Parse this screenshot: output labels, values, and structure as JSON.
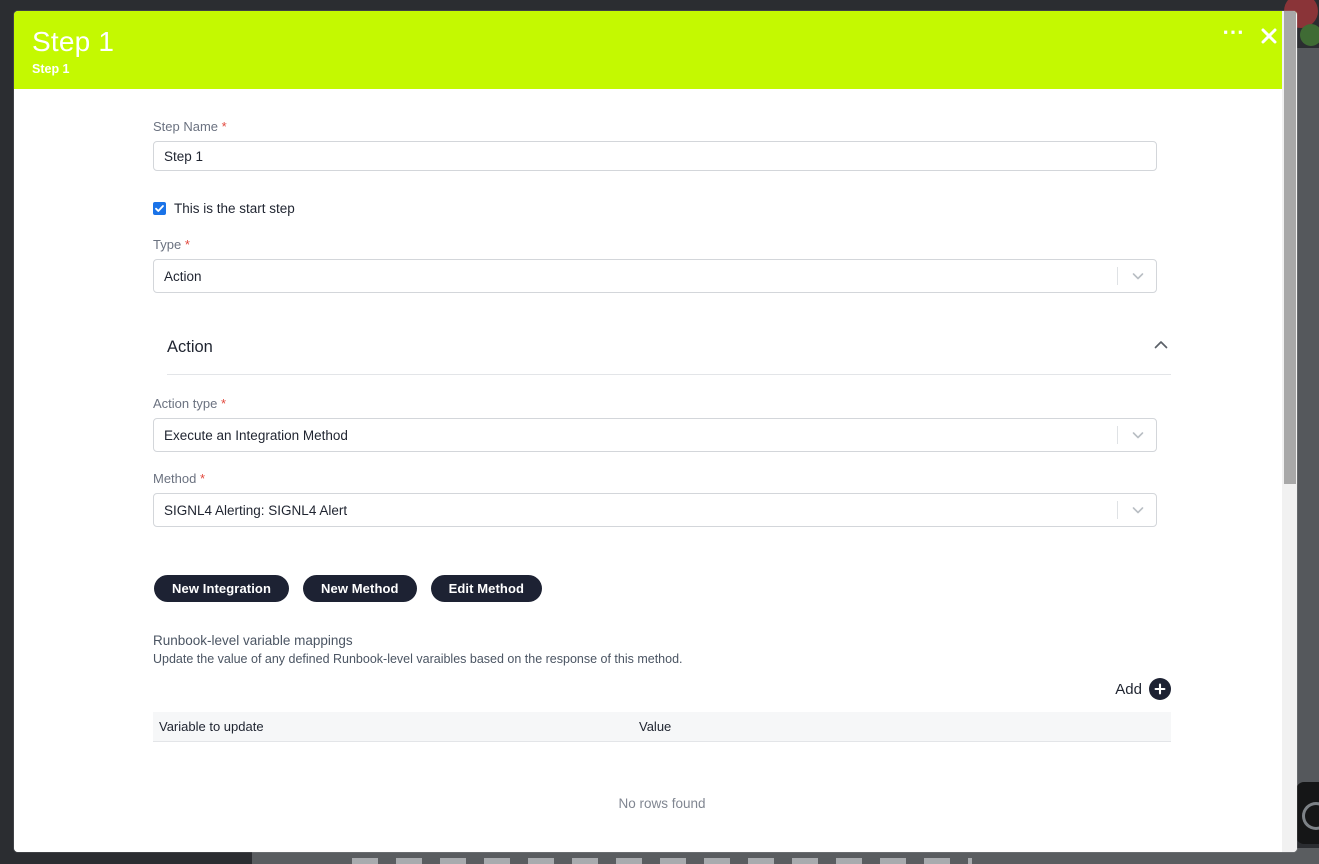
{
  "modal": {
    "title": "Step 1",
    "subtitle": "Step 1",
    "header_color": "#c4f901",
    "more_icon": "more-horizontal-icon",
    "close_icon": "close-icon"
  },
  "form": {
    "step_name": {
      "label": "Step Name",
      "required_marker": "*",
      "value": "Step 1",
      "placeholder": "Step Name"
    },
    "start_step_checkbox": {
      "label": "This is the start step",
      "checked": true,
      "accent": "#1a73e8"
    },
    "type": {
      "label": "Type",
      "required_marker": "*",
      "value": "Action"
    }
  },
  "action_section": {
    "title": "Action",
    "collapse_icon": "chevron-up-icon",
    "action_type": {
      "label": "Action type",
      "required_marker": "*",
      "value": "Execute an Integration Method"
    },
    "method": {
      "label": "Method",
      "required_marker": "*",
      "value": "SIGNL4 Alerting: SIGNL4 Alert"
    },
    "buttons": [
      {
        "label": "New Integration",
        "name": "new-integration-button"
      },
      {
        "label": "New Method",
        "name": "new-method-button"
      },
      {
        "label": "Edit Method",
        "name": "edit-method-button"
      }
    ],
    "button_color": "#1d2233"
  },
  "mappings": {
    "title": "Runbook-level variable mappings",
    "description": "Update the value of any defined Runbook-level varaibles based on the response of this method.",
    "add_label": "Add",
    "add_icon": "plus-icon",
    "columns": [
      "Variable to update",
      "Value"
    ],
    "rows": [],
    "empty_text": "No rows found"
  },
  "scrollbar": {
    "name": "modal-vertical-scrollbar"
  }
}
